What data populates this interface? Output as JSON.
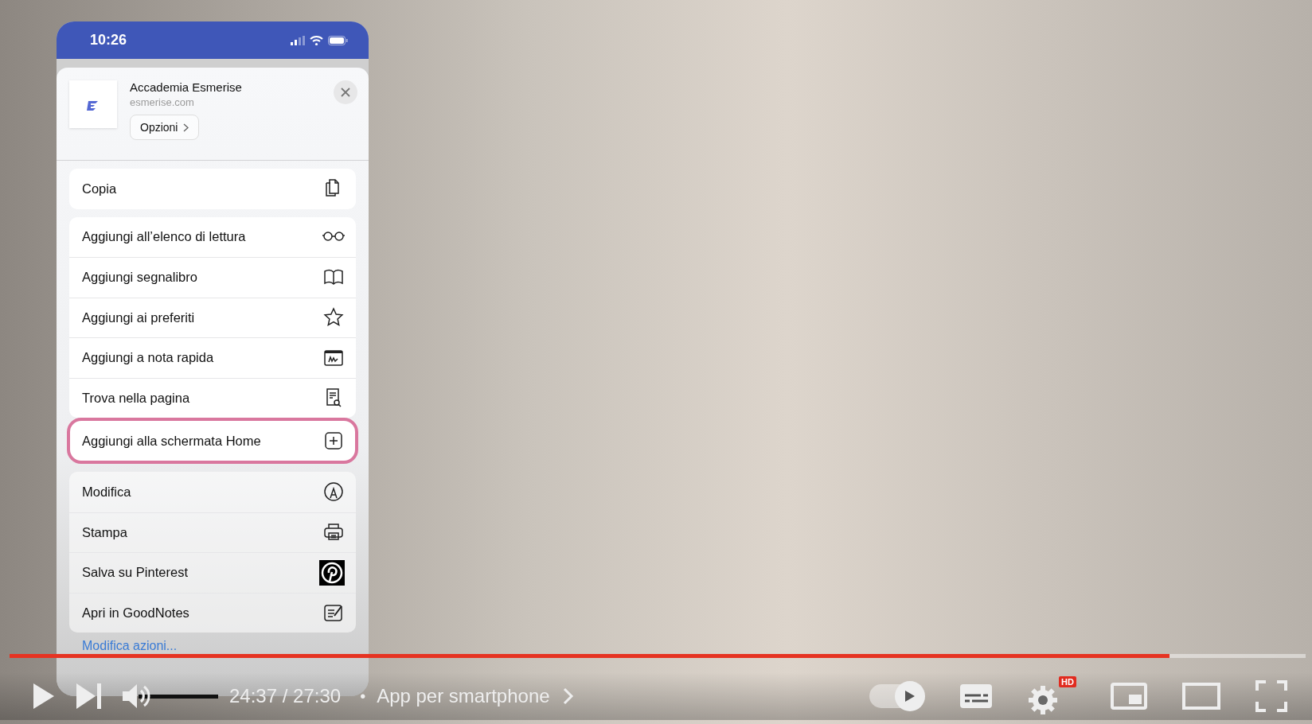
{
  "phone": {
    "status_bar": {
      "time": "10:26"
    },
    "share_sheet": {
      "title": "Accademia Esmerise",
      "domain": "esmerise.com",
      "options_button": "Opzioni",
      "groups": [
        {
          "items": [
            {
              "label": "Copia",
              "highlighted": false
            }
          ]
        },
        {
          "items": [
            {
              "label": "Aggiungi all’elenco di lettura",
              "highlighted": false
            },
            {
              "label": "Aggiungi segnalibro",
              "highlighted": false
            },
            {
              "label": "Aggiungi ai preferiti",
              "highlighted": false
            },
            {
              "label": "Aggiungi a nota rapida",
              "highlighted": false
            },
            {
              "label": "Trova nella pagina",
              "highlighted": false
            }
          ]
        },
        {
          "items": [
            {
              "label": "Aggiungi alla schermata Home",
              "highlighted": true
            }
          ]
        },
        {
          "items": [
            {
              "label": "Modifica",
              "highlighted": false
            },
            {
              "label": "Stampa",
              "highlighted": false
            },
            {
              "label": "Salva su Pinterest",
              "highlighted": false
            },
            {
              "label": "Apri in GoodNotes",
              "highlighted": false
            }
          ]
        }
      ],
      "edit_actions_link": "Modifica azioni..."
    }
  },
  "player": {
    "progress": {
      "level": 0.895
    },
    "volume": {
      "level": 1
    },
    "time": "24:37 / 27:30",
    "separator": "•",
    "chapter": "App per smartphone",
    "autoplay": {
      "on": true
    },
    "quality_badge": "HD"
  }
}
